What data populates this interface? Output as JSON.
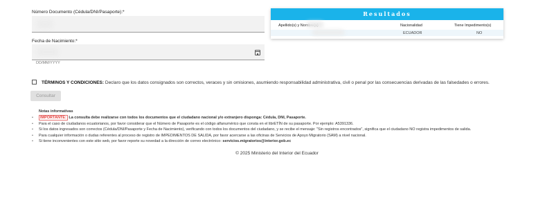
{
  "form": {
    "document_label": "Número Documento (Cédula/DNI/Pasaporte):*",
    "date_label": "Fecha de Nacimiento:*",
    "date_hint": "DD/MM/YYYY"
  },
  "results": {
    "title": "Resultados",
    "columns": [
      "Apellido(s) y Nombre(s)",
      "Nacionalidad",
      "Tiene Impedimento(s)"
    ],
    "row": {
      "name": "",
      "nationality": "ECUADOR",
      "impediment": "NO"
    }
  },
  "terms": {
    "title": "TÉRMINOS Y CONDICIONES:",
    "text": "Declaro que los datos consignados son correctos, veraces y sin omisiones, asumiendo responsabilidad administrativa, civil o penal por las consecuencias derivadas de las falsedades o errores."
  },
  "submit_label": "Consultar",
  "notes": {
    "title": "Notas informativas",
    "important_tag": "IMPORTANTE:",
    "important_text": "La consulta debe realizarse con todos los documentos que el ciudadano nacional y/o extranjero disponga: Cédula, DNI, Pasaporte.",
    "items": [
      "Para el caso de ciudadanos ecuatorianos, por favor considerar que el Número de Pasaporte es el código alfanumérico que consta en el librETÍN de su pasaporte. Por ejemplo: A5391336.",
      "Si los datos ingresados son correctos (Cédula/DNI/Pasaporte y Fecha de Nacimiento), verificando con todos los documentos del ciudadano, y se recibe el mensaje: \"Sin registros encontrados\", significa que el ciudadano NO    registra impedimentos de salida.",
      "Para cualquier información o dudas referentes al proceso de registro de IMPEDIMENTOS DE SALIDA, por favor acercarse a las oficinas de Servicios de Apoyo Migratorio (SAM) a nivel nacional.",
      "Si tiene inconvenientes con este sitio web, por favor reporte su novedad a la dirección de correo electrónico:"
    ],
    "email": "servicios.migratorios@interior.gob.ec"
  },
  "footer": "© 2025 Ministerio del Interior del Ecuador",
  "colors": {
    "accent": "#1ab3ea",
    "important": "#e53935"
  }
}
